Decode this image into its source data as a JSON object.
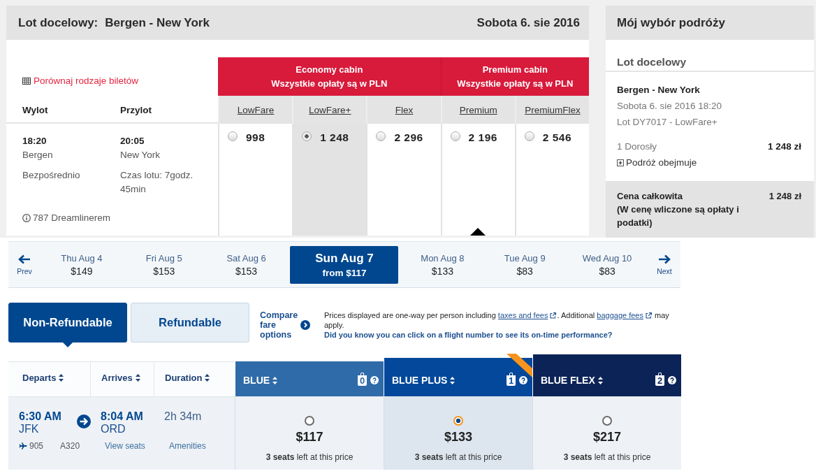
{
  "outbound": {
    "title": "Lot docelowy:",
    "route": "Bergen - New York",
    "date": "Sobota 6. sie 2016",
    "compare_link": "Porównaj rodzaje biletów",
    "columns": [
      "Wylot",
      "Przylot"
    ],
    "cabins": [
      {
        "name": "Economy cabin",
        "note": "Wszystkie opłaty są w PLN",
        "fares": [
          {
            "name": "LowFare",
            "price": "998",
            "selected": false
          },
          {
            "name": "LowFare+",
            "price": "1 248",
            "selected": true
          },
          {
            "name": "Flex",
            "price": "2 296",
            "selected": false
          }
        ]
      },
      {
        "name": "Premium cabin",
        "note": "Wszystkie opłaty są w PLN",
        "fares": [
          {
            "name": "Premium",
            "price": "2 196",
            "selected": false
          },
          {
            "name": "PremiumFlex",
            "price": "2 546",
            "selected": false
          }
        ]
      }
    ],
    "flight": {
      "departure_time": "18:20",
      "departure_city": "Bergen",
      "stops": "Bezpośrednio",
      "arrival_time": "20:05",
      "arrival_city": "New York",
      "duration": "Czas lotu: 7godz. 45min",
      "aircraft": "787 Dreamlinerem"
    }
  },
  "trip_summary": {
    "title": "Mój wybór podróży",
    "section": "Lot docelowy",
    "route": "Bergen - New York",
    "date_time": "Sobota 6. sie 2016 18:20",
    "flight": "Lot DY7017 - LowFare+",
    "passengers": "1 Dorosły",
    "passenger_price": "1 248 zł",
    "includes": {
      "label": "Podróż obejmuje",
      "expanded": false
    },
    "total_label": "Cena całkowita",
    "total_note": "(W cenę wliczone są opłaty i podatki)",
    "total_price": "1 248 zł"
  },
  "date_strip": {
    "prev": "Prev",
    "next": "Next",
    "days": [
      {
        "day": "Thu Aug 4",
        "price": "$149",
        "selected": false
      },
      {
        "day": "Fri Aug 5",
        "price": "$153",
        "selected": false
      },
      {
        "day": "Sat Aug 6",
        "price": "$153",
        "selected": false
      },
      {
        "day": "Sun Aug 7",
        "price": "from $117",
        "selected": true
      },
      {
        "day": "Mon Aug 8",
        "price": "$133",
        "selected": false
      },
      {
        "day": "Tue Aug 9",
        "price": "$83",
        "selected": false
      },
      {
        "day": "Wed Aug 10",
        "price": "$83",
        "selected": false
      }
    ]
  },
  "fare_tabs": [
    {
      "label": "Non-Refundable",
      "selected": true
    },
    {
      "label": "Refundable",
      "selected": false
    }
  ],
  "compare_link": "Compare fare options",
  "notice": {
    "parts": [
      {
        "kind": "text",
        "text": "Prices displayed are one-way per person including "
      },
      {
        "kind": "link",
        "text": "taxes and fees"
      },
      {
        "kind": "text",
        "text": ". Additional "
      },
      {
        "kind": "link",
        "text": "baggage fees"
      },
      {
        "kind": "text",
        "text": " may apply."
      }
    ],
    "tip": "Did you know you can click on a flight number to see its on-time performance?"
  },
  "results": {
    "columns": [
      "Departs",
      "Arrives",
      "Duration"
    ],
    "fares": [
      {
        "name": "BLUE",
        "bags": "0",
        "color": "#2f6ba8",
        "ribbon": false,
        "selected": false,
        "price": "$117",
        "seats": "**3 seats** left at this price"
      },
      {
        "name": "BLUE PLUS",
        "bags": "1",
        "color": "#03489a",
        "ribbon": true,
        "selected": true,
        "price": "$133",
        "seats": "**3 seats** left at this price"
      },
      {
        "name": "BLUE FLEX",
        "bags": "2",
        "color": "#0b2357",
        "ribbon": false,
        "selected": false,
        "price": "$217",
        "seats": "**3 seats** left at this price"
      }
    ],
    "flight": {
      "depart_time": "6:30 AM",
      "depart_airport": "JFK",
      "arrive_time": "8:04 AM",
      "arrive_airport": "ORD",
      "duration": "2h 34m",
      "flight_number": "905",
      "aircraft": "A320",
      "seats_link": "View seats",
      "amenities_link": "Amenities"
    }
  }
}
